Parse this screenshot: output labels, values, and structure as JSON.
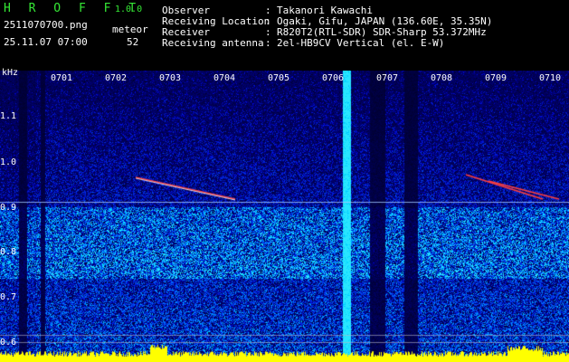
{
  "header": {
    "app_name": "H R O F F T",
    "version": "1.0.0",
    "file_name": "2511070700.png",
    "datetime": "25.11.07 07:00",
    "meteor_label": "meteor",
    "meteor_count": "52"
  },
  "station": [
    {
      "label": "Observer",
      "sep": ":",
      "value": "Takanori Kawachi"
    },
    {
      "label": "Receiving Location",
      "sep": ":",
      "value": "Ogaki, Gifu, JAPAN (136.60E, 35.35N)"
    },
    {
      "label": "Receiver",
      "sep": ":",
      "value": "R820T2(RTL-SDR) SDR-Sharp 53.372MHz"
    },
    {
      "label": "Receiving antenna",
      "sep": ":",
      "value": "2el-HB9CV Vertical (el. E-W)"
    }
  ],
  "axis": {
    "unit": "kHz",
    "y_ticks": [
      "1.1",
      "1.0",
      "0.9",
      "0.8",
      "0.7",
      "0.6"
    ],
    "x_ticks": [
      "0701",
      "0702",
      "0703",
      "0704",
      "0705",
      "0706",
      "0707",
      "0708",
      "0709",
      "0710"
    ]
  },
  "colors": {
    "header_text": "#ffffff",
    "title_green": "#35e835",
    "background": "#000000",
    "noise_low": "#00005a",
    "noise_mid": "#1a3cff",
    "noise_high": "#23c8ff",
    "signal": "#ff3030",
    "baseline": "#ffff00"
  }
}
